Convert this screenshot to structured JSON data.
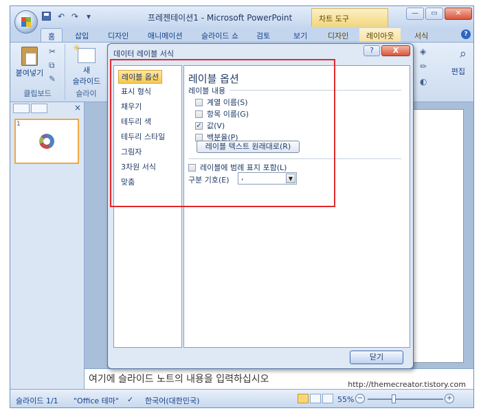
{
  "window": {
    "title": "프레젠테이션1 - Microsoft PowerPoint",
    "context_tab": "차트 도구"
  },
  "ribbon": {
    "tabs": [
      "홈",
      "삽입",
      "디자인",
      "애니메이션",
      "슬라이드 쇼",
      "검토",
      "보기",
      "디자인",
      "레이아웃",
      "서식"
    ],
    "active_tab": "홈",
    "groups": {
      "clipboard_label": "클립보드",
      "paste_label": "붙여넣기",
      "new_slide_label_1": "새",
      "new_slide_label_2": "슬라이드",
      "slides_label": "슬라이",
      "edit_label": "편집"
    }
  },
  "left_pane": {
    "thumb_number": "1"
  },
  "notes": {
    "placeholder": "여기에 슬라이드 노트의 내용을 입력하십시오"
  },
  "watermark": "http://themecreator.tistory.com",
  "statusbar": {
    "slide": "슬라이드 1/1",
    "theme": "\"Office 테마\"",
    "language": "한국어(대한민국)",
    "zoom": "55%"
  },
  "dialog": {
    "title": "데이터 레이블 서식",
    "help": "?",
    "close": "X",
    "nav": [
      "레이블 옵션",
      "표시 형식",
      "채우기",
      "테두리 색",
      "테두리 스타일",
      "그림자",
      "3차원 서식",
      "맞춤"
    ],
    "selected_nav": "레이블 옵션",
    "section_title": "레이블 옵션",
    "content_label": "레이블 내용",
    "options": [
      {
        "label": "계열 이름(S)",
        "checked": false
      },
      {
        "label": "항목 이름(G)",
        "checked": false
      },
      {
        "label": "값(V)",
        "checked": true
      },
      {
        "label": "백분율(P)",
        "checked": false
      }
    ],
    "reset_button": "레이블 텍스트 원래대로(R)",
    "legend_key_option": {
      "label": "레이블에 범례 표지 포함(L)",
      "checked": false
    },
    "separator_label": "구분 기호(E)",
    "separator_value": ",",
    "close_button": "닫기"
  },
  "colors": {
    "highlight": "#e1272b",
    "frame": "#c4d6ee",
    "selected_nav": "#f7c94b"
  }
}
